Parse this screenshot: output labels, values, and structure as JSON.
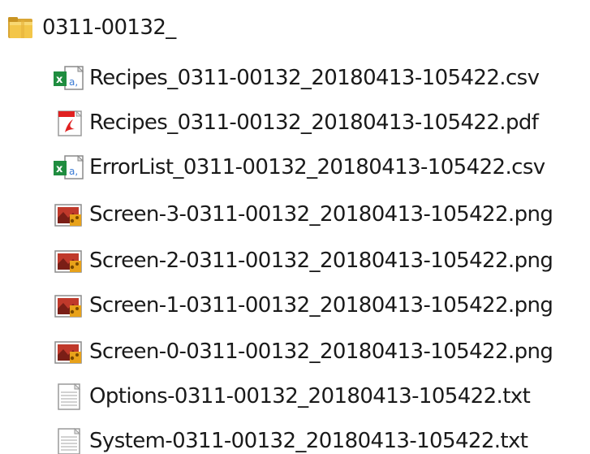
{
  "folder": {
    "name": "0311-00132_",
    "icon": "folder-icon"
  },
  "files": [
    {
      "name": "Recipes_0311-00132_20180413-105422.csv",
      "icon": "csv-excel-icon"
    },
    {
      "name": "Recipes_0311-00132_20180413-105422.pdf",
      "icon": "pdf-icon"
    },
    {
      "name": "ErrorList_0311-00132_20180413-105422.csv",
      "icon": "csv-excel-icon"
    },
    {
      "name": "Screen-3-0311-00132_20180413-105422.png",
      "icon": "png-image-icon"
    },
    {
      "name": "Screen-2-0311-00132_20180413-105422.png",
      "icon": "png-image-icon"
    },
    {
      "name": "Screen-1-0311-00132_20180413-105422.png",
      "icon": "png-image-icon"
    },
    {
      "name": "Screen-0-0311-00132_20180413-105422.png",
      "icon": "png-image-icon"
    },
    {
      "name": "Options-0311-00132_20180413-105422.txt",
      "icon": "txt-file-icon"
    },
    {
      "name": "System-0311-00132_20180413-105422.txt",
      "icon": "txt-file-icon"
    }
  ]
}
